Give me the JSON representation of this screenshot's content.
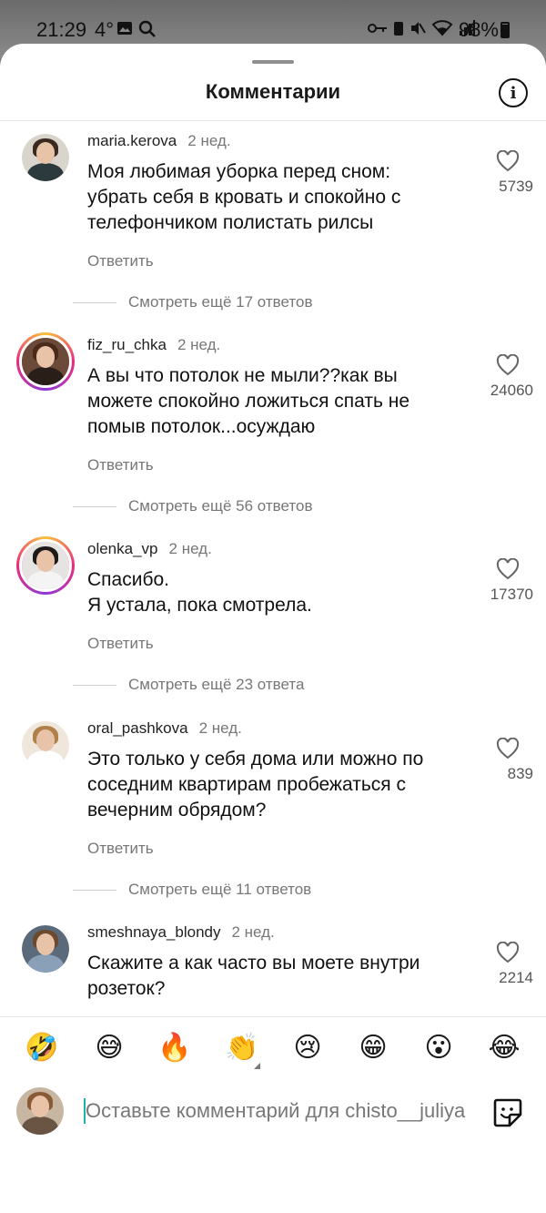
{
  "status_bar": {
    "time": "21:29",
    "temperature": "4°",
    "battery": "98%"
  },
  "header": {
    "title": "Комментарии",
    "info_icon": "info-icon"
  },
  "comments": [
    {
      "username": "maria.kerova",
      "date": "2 нед.",
      "text": "Моя любимая уборка перед сном:\nубрать себя в кровать и спокойно с\nтелефончиком полистать рилсы",
      "reply_label": "Ответить",
      "likes": "5739",
      "more_replies": "Смотреть ещё 17 ответов",
      "avatar_story": false,
      "avatar_colors": {
        "bg": "#d9d4cc",
        "hair": "#3a2a20",
        "body": "#2c3a3e"
      }
    },
    {
      "username": "fiz_ru_chka",
      "date": "2 нед.",
      "text": "А вы что потолок не мыли??как вы\nможете спокойно ложиться спать не\nпомыв потолок...осуждаю",
      "reply_label": "Ответить",
      "likes": "24060",
      "more_replies": "Смотреть ещё 56 ответов",
      "avatar_story": true,
      "avatar_colors": {
        "bg": "#6b4a3a",
        "hair": "#4a2a18",
        "body": "#2a1e18"
      }
    },
    {
      "username": "olenka_vp",
      "date": "2 нед.",
      "text": "Спасибо.\nЯ устала, пока смотрела.",
      "reply_label": "Ответить",
      "likes": "17370",
      "more_replies": "Смотреть ещё 23 ответа",
      "avatar_story": true,
      "avatar_colors": {
        "bg": "#e6e4e2",
        "hair": "#1e1a18",
        "body": "#f4f4f4"
      }
    },
    {
      "username": "oral_pashkova",
      "date": "2 нед.",
      "text": "Это только у себя дома или можно по\nсоседним квартирам пробежаться с\nвечерним обрядом?",
      "reply_label": "Ответить",
      "likes": "839",
      "more_replies": "Смотреть ещё 11 ответов",
      "avatar_story": false,
      "avatar_colors": {
        "bg": "#efe6dc",
        "hair": "#b0804a",
        "body": "#ffffff"
      }
    },
    {
      "username": "smeshnaya_blondy",
      "date": "2 нед.",
      "text": "Скажите а как часто вы моете внутри\nрозеток?",
      "reply_label": "",
      "likes": "2214",
      "more_replies": "",
      "avatar_story": false,
      "avatar_colors": {
        "bg": "#5a6a7a",
        "hair": "#6b4a30",
        "body": "#8aa0b8"
      }
    }
  ],
  "emoji_bar": [
    {
      "name": "rofl-emoji",
      "glyph": "🤣"
    },
    {
      "name": "sweat-smile-emoji",
      "glyph": "😅"
    },
    {
      "name": "fire-emoji",
      "glyph": "🔥"
    },
    {
      "name": "clap-emoji",
      "glyph": "👏"
    },
    {
      "name": "crying-emoji",
      "glyph": "😢"
    },
    {
      "name": "grin-emoji",
      "glyph": "😁"
    },
    {
      "name": "astonished-emoji",
      "glyph": "😮"
    },
    {
      "name": "joy-emoji",
      "glyph": "😂"
    }
  ],
  "composer": {
    "placeholder": "Оставьте комментарий для chisto__juliya",
    "sticker_icon": "sticker-icon"
  },
  "nav": {
    "recent_icon": "recent-apps-icon",
    "home_icon": "home-icon",
    "back_icon": "back-icon"
  },
  "colors": {
    "accent_cursor": "#1bb3a5",
    "muted_text": "#777777"
  }
}
